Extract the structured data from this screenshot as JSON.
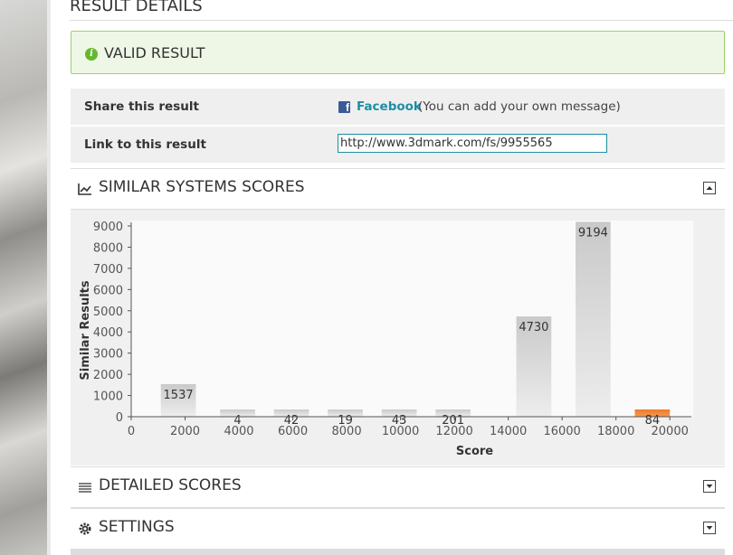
{
  "page": {
    "header": "RESULT DETAILS",
    "valid": "VALID RESULT",
    "share_label": "Share this result",
    "facebook_label": "Facebook",
    "facebook_note": "(You can add your own message)",
    "link_label": "Link to this result",
    "link_url": "http://www.3dmark.com/fs/9955565",
    "similar_title": "SIMILAR SYSTEMS SCORES",
    "detailed_title": "DETAILED SCORES",
    "settings_title": "SETTINGS",
    "colors": {
      "accent": "#1a8fa3",
      "valid_border": "#9dd36a",
      "highlight_bar": "#f07a28",
      "bar": "#d4d4d4"
    },
    "icons": {
      "valid": "info-circle-icon",
      "facebook": "facebook-icon",
      "similar": "line-chart-icon",
      "detailed": "list-icon",
      "settings": "gear-icon"
    }
  },
  "chart_data": {
    "type": "bar",
    "x": [
      2000,
      4000,
      6000,
      8000,
      10000,
      12000,
      14000,
      16000,
      18000,
      20000
    ],
    "values": [
      1537,
      4,
      42,
      19,
      43,
      201,
      4730,
      9194,
      84
    ],
    "bin_centers": [
      1750,
      3950,
      5950,
      7950,
      9950,
      11950,
      14950,
      17150,
      19350
    ],
    "highlight_index": 8,
    "xlabel": "Score",
    "ylabel": "Similar Results",
    "xlim": [
      0,
      20800
    ],
    "ylim": [
      0,
      9000
    ],
    "yticks": [
      0,
      1000,
      2000,
      3000,
      4000,
      5000,
      6000,
      7000,
      8000,
      9000
    ],
    "xticks": [
      0,
      2000,
      4000,
      6000,
      8000,
      10000,
      12000,
      14000,
      16000,
      18000,
      20000
    ]
  }
}
